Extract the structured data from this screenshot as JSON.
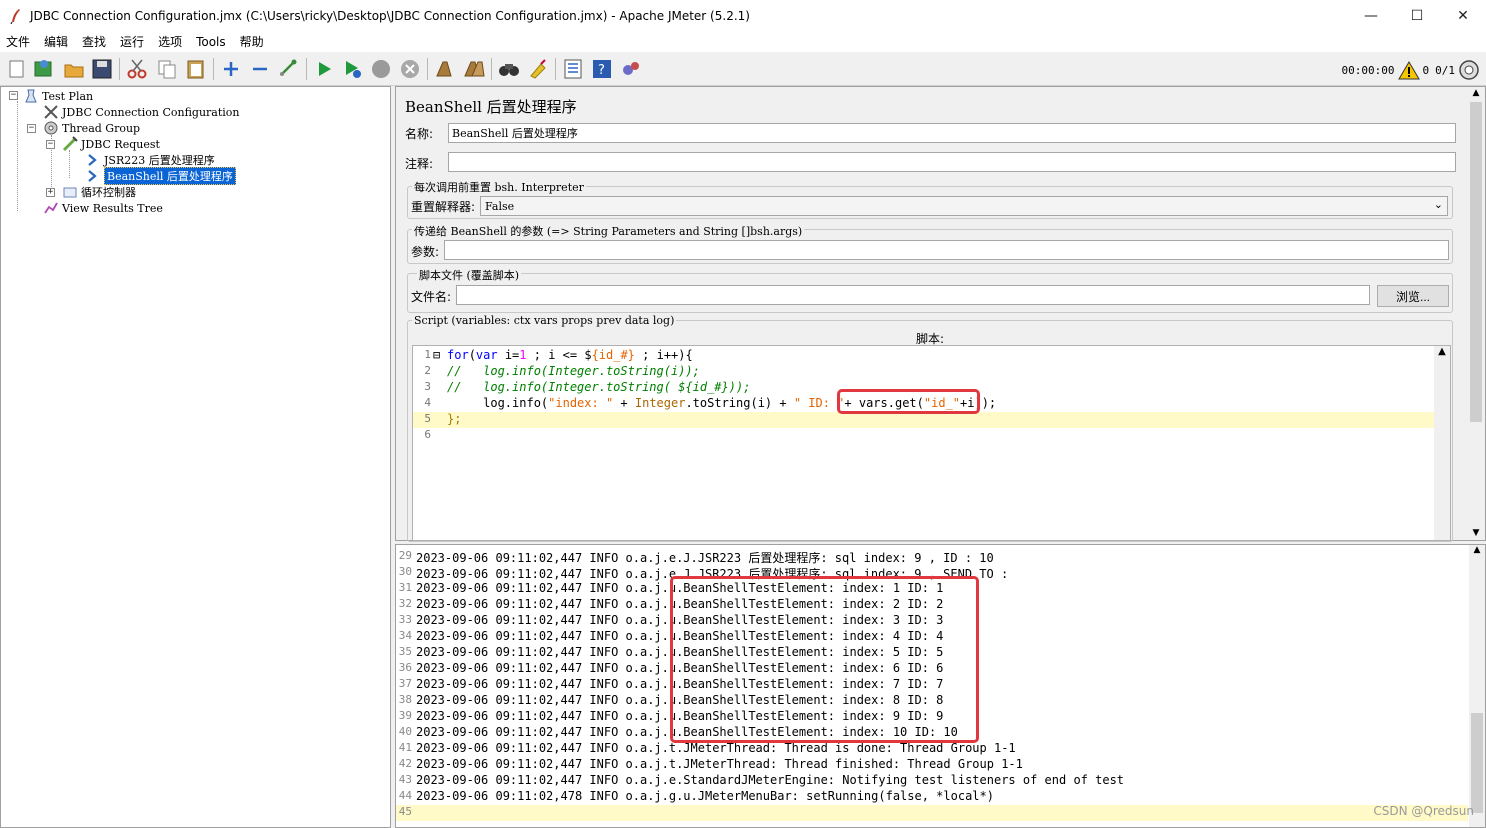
{
  "window": {
    "title": "JDBC Connection Configuration.jmx (C:\\Users\\ricky\\Desktop\\JDBC Connection Configuration.jmx) - Apache JMeter (5.2.1)",
    "minimize": "—",
    "maximize": "☐",
    "close": "✕"
  },
  "menu": [
    "文件",
    "编辑",
    "查找",
    "运行",
    "选项",
    "Tools",
    "帮助"
  ],
  "toolbar": {
    "timer": "00:00:00",
    "warnings": "0",
    "threads": "0/1"
  },
  "tree": {
    "items": [
      {
        "label": "Test Plan",
        "icon": "test-plan-icon"
      },
      {
        "label": "JDBC Connection Configuration",
        "icon": "config-icon"
      },
      {
        "label": "Thread Group",
        "icon": "thread-group-icon"
      },
      {
        "label": "JDBC Request",
        "icon": "sampler-icon"
      },
      {
        "label": "JSR223 后置处理程序",
        "icon": "post-processor-icon"
      },
      {
        "label": "BeanShell 后置处理程序",
        "icon": "post-processor-icon"
      },
      {
        "label": "循环控制器",
        "icon": "loop-controller-icon"
      },
      {
        "label": "View Results Tree",
        "icon": "listener-icon"
      }
    ]
  },
  "panel": {
    "title": "BeanShell 后置处理程序",
    "name_label": "名称:",
    "name_value": "BeanShell 后置处理程序",
    "comment_label": "注释:",
    "comment_value": "",
    "reset_group_title": "每次调用前重置 bsh. Interpreter",
    "reset_label": "重置解释器:",
    "reset_value": "False",
    "params_group_title": "传递给 BeanShell 的参数 (=> String Parameters and String []bsh.args)",
    "params_label": "参数:",
    "params_value": "",
    "file_group_title": "脚本文件 (覆盖脚本)",
    "file_label": "文件名:",
    "file_value": "",
    "browse_label": "浏览...",
    "script_group_title": "Script (variables: ctx vars props prev data log)",
    "script_label": "脚本:"
  },
  "script_lines": [
    "for(var i=1 ; i <= ${id_#} ; i++){",
    "//   log.info(Integer.toString(i));",
    "//   log.info(Integer.toString( ${id_#}));",
    "     log.info(\"index: \" + Integer.toString(i) + \" ID: \"+ vars.get(\"id_\"+i));",
    "};",
    ""
  ],
  "log_lines": [
    {
      "n": "29",
      "text": "2023-09-06 09:11:02,447 INFO o.a.j.e.J.JSR223 后置处理程序: sql index: 9 , ID : 10"
    },
    {
      "n": "30",
      "text": "2023-09-06 09:11:02,447 INFO o.a.j.e.J.JSR223 后置处理程序: sql index: 9 , SEND TO :"
    },
    {
      "n": "31",
      "text": "2023-09-06 09:11:02,447 INFO o.a.j.u.BeanShellTestElement: index: 1 ID: 1"
    },
    {
      "n": "32",
      "text": "2023-09-06 09:11:02,447 INFO o.a.j.u.BeanShellTestElement: index: 2 ID: 2"
    },
    {
      "n": "33",
      "text": "2023-09-06 09:11:02,447 INFO o.a.j.u.BeanShellTestElement: index: 3 ID: 3"
    },
    {
      "n": "34",
      "text": "2023-09-06 09:11:02,447 INFO o.a.j.u.BeanShellTestElement: index: 4 ID: 4"
    },
    {
      "n": "35",
      "text": "2023-09-06 09:11:02,447 INFO o.a.j.u.BeanShellTestElement: index: 5 ID: 5"
    },
    {
      "n": "36",
      "text": "2023-09-06 09:11:02,447 INFO o.a.j.u.BeanShellTestElement: index: 6 ID: 6"
    },
    {
      "n": "37",
      "text": "2023-09-06 09:11:02,447 INFO o.a.j.u.BeanShellTestElement: index: 7 ID: 7"
    },
    {
      "n": "38",
      "text": "2023-09-06 09:11:02,447 INFO o.a.j.u.BeanShellTestElement: index: 8 ID: 8"
    },
    {
      "n": "39",
      "text": "2023-09-06 09:11:02,447 INFO o.a.j.u.BeanShellTestElement: index: 9 ID: 9"
    },
    {
      "n": "40",
      "text": "2023-09-06 09:11:02,447 INFO o.a.j.u.BeanShellTestElement: index: 10 ID: 10"
    },
    {
      "n": "41",
      "text": "2023-09-06 09:11:02,447 INFO o.a.j.t.JMeterThread: Thread is done: Thread Group 1-1"
    },
    {
      "n": "42",
      "text": "2023-09-06 09:11:02,447 INFO o.a.j.t.JMeterThread: Thread finished: Thread Group 1-1"
    },
    {
      "n": "43",
      "text": "2023-09-06 09:11:02,447 INFO o.a.j.e.StandardJMeterEngine: Notifying test listeners of end of test"
    },
    {
      "n": "44",
      "text": "2023-09-06 09:11:02,478 INFO o.a.j.g.u.JMeterMenuBar: setRunning(false, *local*)"
    },
    {
      "n": "45",
      "text": ""
    }
  ],
  "watermark": "CSDN @Qredsun",
  "colors": {
    "selection": "#0a64d6",
    "highlight_box": "#e0383e",
    "current_line": "#fffac8"
  }
}
